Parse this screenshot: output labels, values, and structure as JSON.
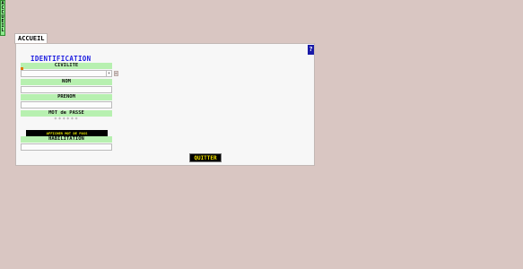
{
  "sidebar": {
    "vertical_tab_label": "ACCUEIL"
  },
  "tabs": {
    "active_label": "ACCUEIL"
  },
  "form": {
    "help_label": "?",
    "section_title": "IDENTIFICATION",
    "civilite": {
      "label": "CIVILITE",
      "value": ""
    },
    "nom": {
      "label": "NOM",
      "value": ""
    },
    "prenom": {
      "label": "PRENOM",
      "value": ""
    },
    "mot_de_passe": {
      "label": "MOT de PASSE",
      "masked_value": "******"
    },
    "show_password_label": "AFFICHER MOT DE PASS",
    "habilitation": {
      "label": "HABILITATION",
      "value": ""
    }
  },
  "actions": {
    "quit_label": "QUITTER"
  },
  "colors": {
    "background": "#d9c6c2",
    "header_green": "#b7f0b0",
    "title_blue": "#1c1ce0",
    "required_marker": "#e07a00",
    "button_text_yellow": "#f0e000"
  }
}
